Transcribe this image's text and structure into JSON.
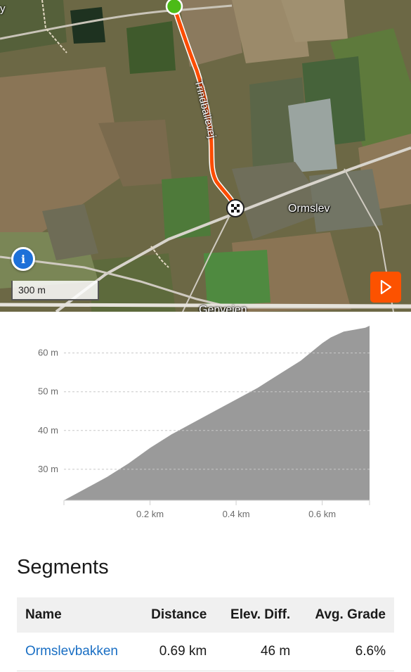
{
  "map": {
    "labels": {
      "town": "Ormslev",
      "street_route": "Trindballevej",
      "street_bottom": "Genvejen",
      "street_topleft": "y"
    },
    "scale": "300 m",
    "info_icon": "info-icon",
    "play_icon": "play-icon",
    "colors": {
      "route": "#fc4c02",
      "start": "#4cbb17",
      "accent": "#fc5200",
      "info": "#1d70d8"
    }
  },
  "elevation": {
    "chart_data": {
      "type": "area",
      "title": "",
      "xlabel": "",
      "ylabel": "",
      "x_unit": "km",
      "y_unit": "m",
      "x": [
        0.0,
        0.05,
        0.1,
        0.15,
        0.2,
        0.25,
        0.3,
        0.35,
        0.4,
        0.45,
        0.5,
        0.55,
        0.6,
        0.62,
        0.65,
        0.7,
        0.71
      ],
      "y": [
        22,
        25,
        28,
        31.5,
        35.5,
        39,
        42,
        45,
        48,
        51,
        54.5,
        58,
        62.5,
        64,
        65.5,
        66.5,
        67
      ],
      "xlim": [
        0,
        0.71
      ],
      "ylim": [
        22,
        67
      ],
      "xticks": [
        "0.2 km",
        "0.4 km",
        "0.6 km"
      ],
      "xtick_values": [
        0.2,
        0.4,
        0.6
      ],
      "yticks": [
        "30 m",
        "40 m",
        "50 m",
        "60 m"
      ],
      "ytick_values": [
        30,
        40,
        50,
        60
      ],
      "grid": "horizontal dashed",
      "fill_color": "#9a9a9a"
    }
  },
  "segments": {
    "title": "Segments",
    "columns": [
      "Name",
      "Distance",
      "Elev. Diff.",
      "Avg. Grade"
    ],
    "rows": [
      {
        "name": "Ormslevbakken",
        "distance": "0.69 km",
        "elev_diff": "46 m",
        "avg_grade": "6.6%"
      }
    ]
  }
}
